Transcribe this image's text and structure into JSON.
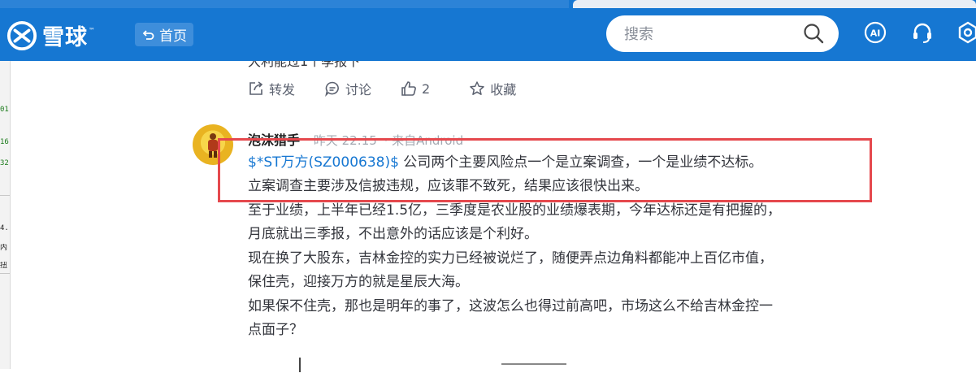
{
  "header": {
    "logo_text": "雪球",
    "logo_tm": "™",
    "home_label": "首页",
    "search_placeholder": "搜索",
    "brand_color": "#1677d2"
  },
  "icons": {
    "logo": "snowball-logo-icon",
    "home": "back-arrow-icon",
    "search": "magnifier-icon",
    "ai": "ai-icon",
    "support": "headset-icon",
    "settings": "gear-icon",
    "repost": "share-icon",
    "comment": "comment-icon",
    "like": "thumbs-up-icon",
    "favorite": "star-icon"
  },
  "prev_post": {
    "cut_text": "大利能过1个季报下"
  },
  "actions": {
    "repost_label": "转发",
    "comment_label": "讨论",
    "like_count": "2",
    "favorite_label": "收藏"
  },
  "post": {
    "author": "泡沫猎手",
    "time": "昨天 22:15",
    "source": "· 来自Android",
    "stock_tag": "$*ST万方(SZ000638)$",
    "lines": [
      " 公司两个主要风险点一个是立案调查，一个是业绩不达标。",
      "立案调查主要涉及信披违规，应该罪不致死，结果应该很快出来。",
      "至于业绩，上半年已经1.5亿，三季度是农业股的业绩爆表期，今年达标还是有把握的，",
      "月底就出三季报，不出意外的话应该是个利好。",
      "现在换了大股东，吉林金控的实力已经被说烂了，随便弄点边角料都能冲上百亿市值，",
      "保住壳，迎接万方的就是星辰大海。",
      "如果保不住壳，那也是明年的事了，这波怎么也得过前高吧，市场这么不给吉林金控一",
      "点面子？"
    ]
  },
  "left_strip": {
    "values": [
      "73",
      "73",
      "01",
      "16",
      "32",
      "4.",
      "内",
      "扭"
    ]
  },
  "highlight_color": "#e5484d"
}
